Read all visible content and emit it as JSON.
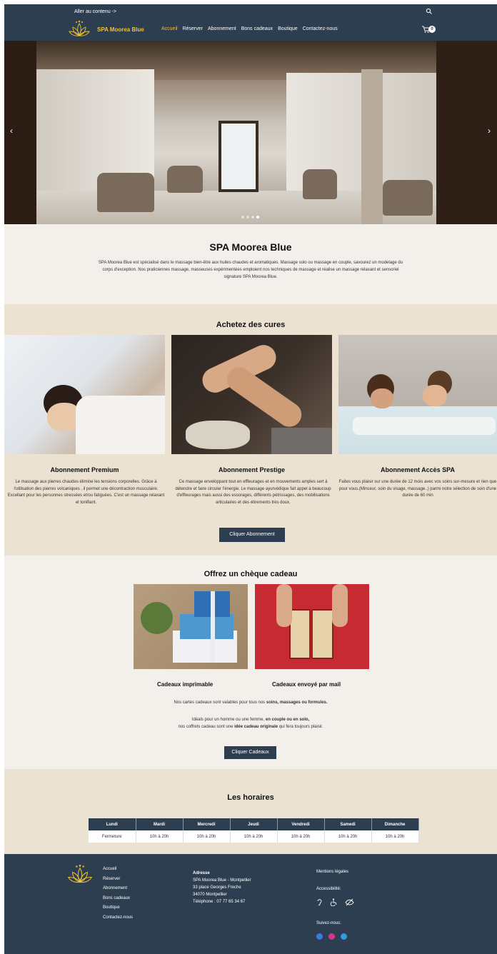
{
  "header": {
    "skip_link": "Aller au contenu ->",
    "brand": "SPA Moorea Blue",
    "nav": [
      "Accueil",
      "Réserver",
      "Abonnement",
      "Bons cadeaux",
      "Boutique",
      "Contactez-nous"
    ],
    "active_nav": "Accueil",
    "cart_count": "0"
  },
  "hero": {
    "slide_count": 4,
    "active_slide": 4
  },
  "intro": {
    "title": "SPA Moorea Blue",
    "text": "SPA Moorea Blue est spécialisé dans le massage bien-être aux huiles chaudes et aromatiques. Massage solo ou massage en couple, savourez un modelage du corps d'exception. Nos praticiennes massage, masseuses expérimentées emploient nos techniques de massage et réalise un massage relaxant et sensoriel signature SPA Moorea Blue."
  },
  "cures": {
    "title": "Achetez des cures",
    "cards": [
      {
        "title": "Abonnement Premium",
        "text": "Le massage aux pierres chaudes élimine les tensions corporelles. Grâce à l'utilisation des pierres volcaniques , il permet une décontraction musculaire. Excellant pour les personnes stressées et/ou fatiguées. C'est un massage relaxant et tonifiant."
      },
      {
        "title": "Abonnement Prestige",
        "text": "Ce massage enveloppant tout en effleurages et en mouvements amples sert à détendre et faire circuler l'énergie. Le massage ayurvédique fait appel à beaucoup d'effleurages mais aussi des essorages, différents pétrissages, des mobilisations articulaires et des étirements très doux."
      },
      {
        "title": "Abonnement Accès SPA",
        "text": "Faites vous plaisir sur une durée de 12 mois avec vos soins sur-mesure et rien que pour vous.(Minceur, soin du visage, massage..) parmi notre sélection de soin d'une durée de 60 min"
      }
    ],
    "button": "Cliquer Abonnement"
  },
  "gift": {
    "title": "Offrez un chèque cadeau",
    "items": [
      "Cadeaux imprimable",
      "Cadeaux envoyé par mail"
    ],
    "line1_a": "Nos cartes cadeaux sont valables pour tous nos ",
    "line1_b": "soins, massages ou formules.",
    "line2_a": "Idéals pour un homme ou une femme, ",
    "line2_b": "en couple ou en solo,",
    "line3_a": "nos coffrets cadeau sont une ",
    "line3_b": "idée cadeau originale",
    "line3_c": " qui fera toujours plaisir.",
    "button": "Cliquer Cadeaux"
  },
  "hours": {
    "title": "Les horaires",
    "days": [
      "Lundi",
      "Mardi",
      "Mercredi",
      "Jeudi",
      "Vendredi",
      "Samedi",
      "Dimanche"
    ],
    "values": [
      "Fermeture",
      "10h à 20h",
      "10h à 20h",
      "10h à 20h",
      "10h à 20h",
      "10h à 20h",
      "10h à 20h"
    ]
  },
  "footer": {
    "links": [
      "Accueil",
      "Réserver",
      "Abonnement",
      "Bons cadeaux",
      "Boutique",
      "Contactez-nous"
    ],
    "address_title": "Adresse",
    "address_lines": [
      "SPA Moorea Blue - Montpellier",
      "33 place Georges Freche",
      "34070 Montpellier",
      "Téléphone : 07 77 65 34 67"
    ],
    "legal": "Mentions légales",
    "accessibility": "Accessibilité:",
    "follow": "Suivez-nous:"
  },
  "colors": {
    "navy": "#2c3e50",
    "gold": "#f2c230",
    "beige": "#ebe2d2",
    "cream": "#f3efea"
  }
}
